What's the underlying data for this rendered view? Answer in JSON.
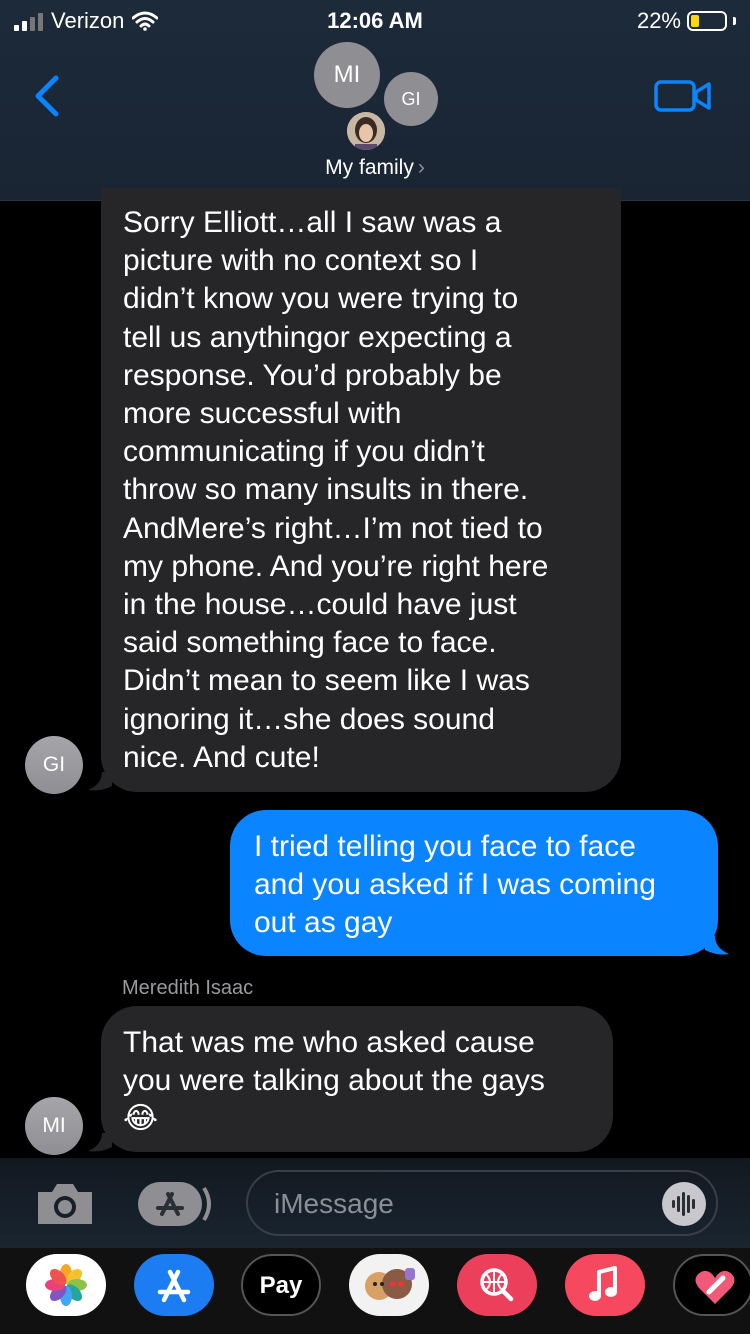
{
  "status_bar": {
    "carrier": "Verizon",
    "time": "12:06 AM",
    "battery_percent": "22%",
    "battery_level": 0.22
  },
  "header": {
    "avatars": [
      "MI",
      "GI"
    ],
    "group_name": "My family",
    "chevron": "›"
  },
  "messages": [
    {
      "direction": "incoming",
      "avatar": "GI",
      "lines": [
        "Sorry Elliott…all I saw was a",
        "picture with no context so I",
        "didn’t know you were trying to",
        "tell us anythingor expecting a",
        "response.  You’d probably be",
        "more successful with",
        "communicating if you didn’t",
        "throw so many insults in there.",
        "AndMere’s  right…I’m not tied to",
        "my phone.  And you’re right here",
        "in the house…could have just",
        "said something face to face.",
        "Didn’t mean to seem like I was",
        "ignoring it…she does sound",
        "nice.  And cute!"
      ]
    },
    {
      "direction": "outgoing",
      "lines": [
        "I tried telling you face to face",
        "and you asked if I was coming",
        "out as gay"
      ]
    },
    {
      "direction": "incoming",
      "sender": "Meredith Isaac",
      "avatar": "MI",
      "lines": [
        "That was me who asked cause",
        "you were talking about the gays",
        "😂"
      ]
    }
  ],
  "input": {
    "placeholder": "iMessage"
  },
  "app_drawer": {
    "apps": [
      "photos-icon",
      "app-store-icon",
      "apple-pay-icon",
      "memoji-icon",
      "web-search-icon",
      "music-icon",
      "digital-touch-icon"
    ],
    "pay_label": " Pay"
  },
  "colors": {
    "accent": "#0a84ff",
    "incoming_bubble": "#262628",
    "outgoing_bubble": "#0a84ff",
    "header_bg": "#1c2a3a",
    "avatar_gray": "#8e8e93"
  }
}
